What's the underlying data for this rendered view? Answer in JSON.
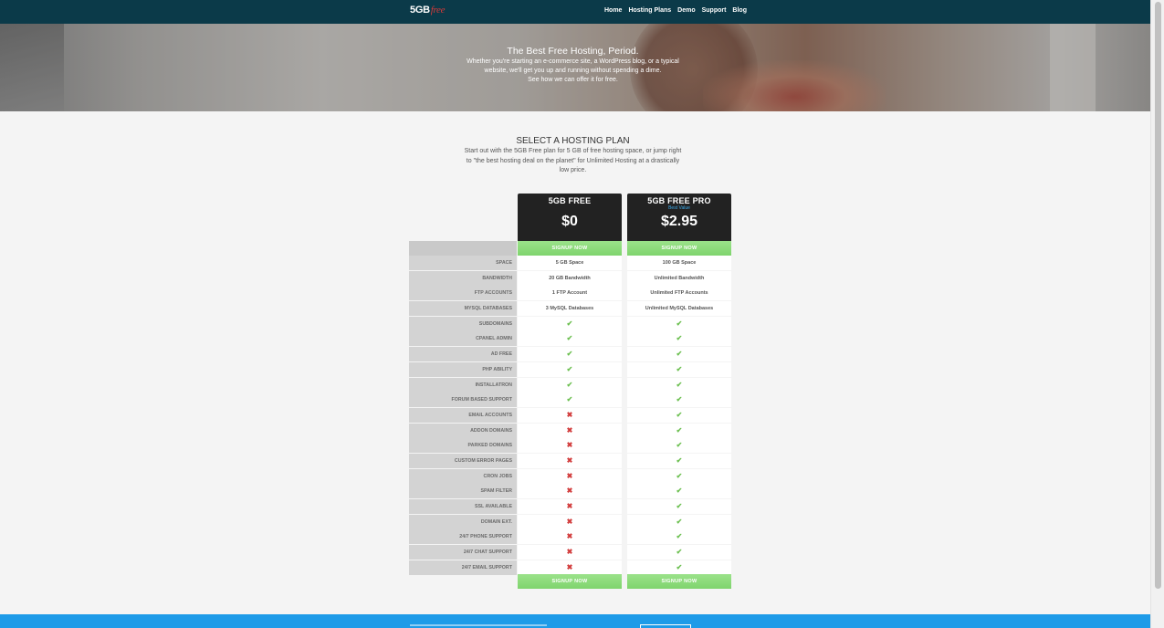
{
  "brand": {
    "logo_main": "5GB",
    "logo_accent": "free"
  },
  "nav": [
    "Home",
    "Hosting Plans",
    "Demo",
    "Support",
    "Blog"
  ],
  "hero": {
    "title": "The Best Free Hosting, Period.",
    "line1": "Whether you're starting an e-commerce site, a WordPress blog, or a typical",
    "line2": "website, we'll get you up and running without spending a dime.",
    "line3": "See how we can offer it for free."
  },
  "section": {
    "title": "SELECT A HOSTING PLAN",
    "line1": "Start out with the 5GB Free plan for 5 GB of free hosting space, or jump right",
    "line2": "to \"the best hosting deal on the planet\" for Unlimited Hosting at a drastically",
    "line3": "low price."
  },
  "plans": [
    {
      "name": "5GB FREE",
      "tag": "",
      "price": "$0",
      "signup": "SIGNUP NOW"
    },
    {
      "name": "5GB FREE PRO",
      "tag": "Best Value",
      "price": "$2.95",
      "signup": "SIGNUP NOW"
    }
  ],
  "features": [
    {
      "label": "SPACE",
      "free": "5 GB Space",
      "pro": "100 GB Space"
    },
    {
      "label": "BANDWIDTH",
      "free": "20 GB Bandwidth",
      "pro": "Unlimited Bandwidth"
    },
    {
      "label": "FTP ACCOUNTS",
      "free": "1 FTP Account",
      "pro": "Unlimited FTP Accounts"
    },
    {
      "label": "MYSQL DATABASES",
      "free": "3 MySQL Databases",
      "pro": "Unlimited MySQL Databases"
    },
    {
      "label": "SUBDOMAINS",
      "free": "check",
      "pro": "check"
    },
    {
      "label": "CPANEL ADMIN",
      "free": "check",
      "pro": "check"
    },
    {
      "label": "AD FREE",
      "free": "check",
      "pro": "check"
    },
    {
      "label": "PHP ABILITY",
      "free": "check",
      "pro": "check"
    },
    {
      "label": "INSTALLATRON",
      "free": "check",
      "pro": "check"
    },
    {
      "label": "FORUM BASED SUPPORT",
      "free": "check",
      "pro": "check"
    },
    {
      "label": "EMAIL ACCOUNTS",
      "free": "cross",
      "pro": "check"
    },
    {
      "label": "ADDON DOMAINS",
      "free": "cross",
      "pro": "check"
    },
    {
      "label": "PARKED DOMAINS",
      "free": "cross",
      "pro": "check"
    },
    {
      "label": "CUSTOM ERROR PAGES",
      "free": "cross",
      "pro": "check"
    },
    {
      "label": "CRON JOBS",
      "free": "cross",
      "pro": "check"
    },
    {
      "label": "SPAM FILTER",
      "free": "cross",
      "pro": "check"
    },
    {
      "label": "SSL AVAILABLE",
      "free": "cross",
      "pro": "check"
    },
    {
      "label": "DOMAIN EXT.",
      "free": "cross",
      "pro": "check"
    },
    {
      "label": "24/7 PHONE SUPPORT",
      "free": "cross",
      "pro": "check"
    },
    {
      "label": "24/7 CHAT SUPPORT",
      "free": "cross",
      "pro": "check"
    },
    {
      "label": "24/7 EMAIL SUPPORT",
      "free": "cross",
      "pro": "check"
    }
  ],
  "colors": {
    "nav": "#0b3a49",
    "signup": "#7fd46d",
    "check": "#6bbf4f",
    "cross": "#d23b3b",
    "footer": "#1e9be8",
    "best_value": "#3aa8e8"
  }
}
